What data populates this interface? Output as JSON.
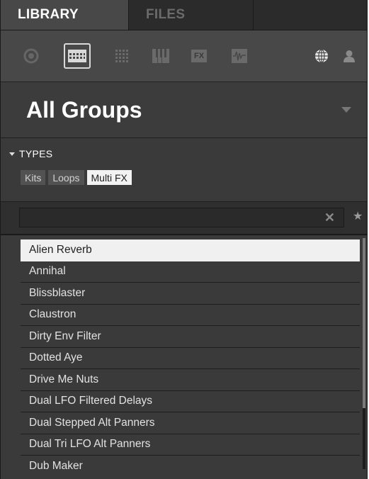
{
  "tabs": [
    {
      "label": "LIBRARY",
      "active": true
    },
    {
      "label": "FILES",
      "active": false
    }
  ],
  "toolbar": {
    "icons": [
      "record-icon",
      "kit-grid-icon",
      "sample-grid-icon",
      "keys-icon",
      "fx-icon",
      "waveform-icon",
      "globe-icon",
      "user-icon"
    ],
    "fx_label": "FX",
    "active_icon": "kit-grid-icon"
  },
  "group_selector": {
    "title": "All Groups"
  },
  "types": {
    "header": "TYPES",
    "chips": [
      {
        "label": "Kits",
        "selected": false
      },
      {
        "label": "Loops",
        "selected": false
      },
      {
        "label": "Multi FX",
        "selected": true
      }
    ]
  },
  "search": {
    "value": "",
    "placeholder": "",
    "clear_glyph": "✕",
    "favorite_glyph": "★"
  },
  "results": [
    "Alien Reverb",
    "Annihal",
    "Blissblaster",
    "Claustron",
    "Dirty Env Filter",
    "Dotted Aye",
    "Drive Me Nuts",
    "Dual LFO Filtered Delays",
    "Dual Stepped Alt Panners",
    "Dual Tri LFO Alt Panners",
    "Dub Maker"
  ],
  "selected_result": "Alien Reverb",
  "colors": {
    "background": "#3a3a3a",
    "selected_row": "#f0f0f0",
    "tab_active": "#484848"
  }
}
